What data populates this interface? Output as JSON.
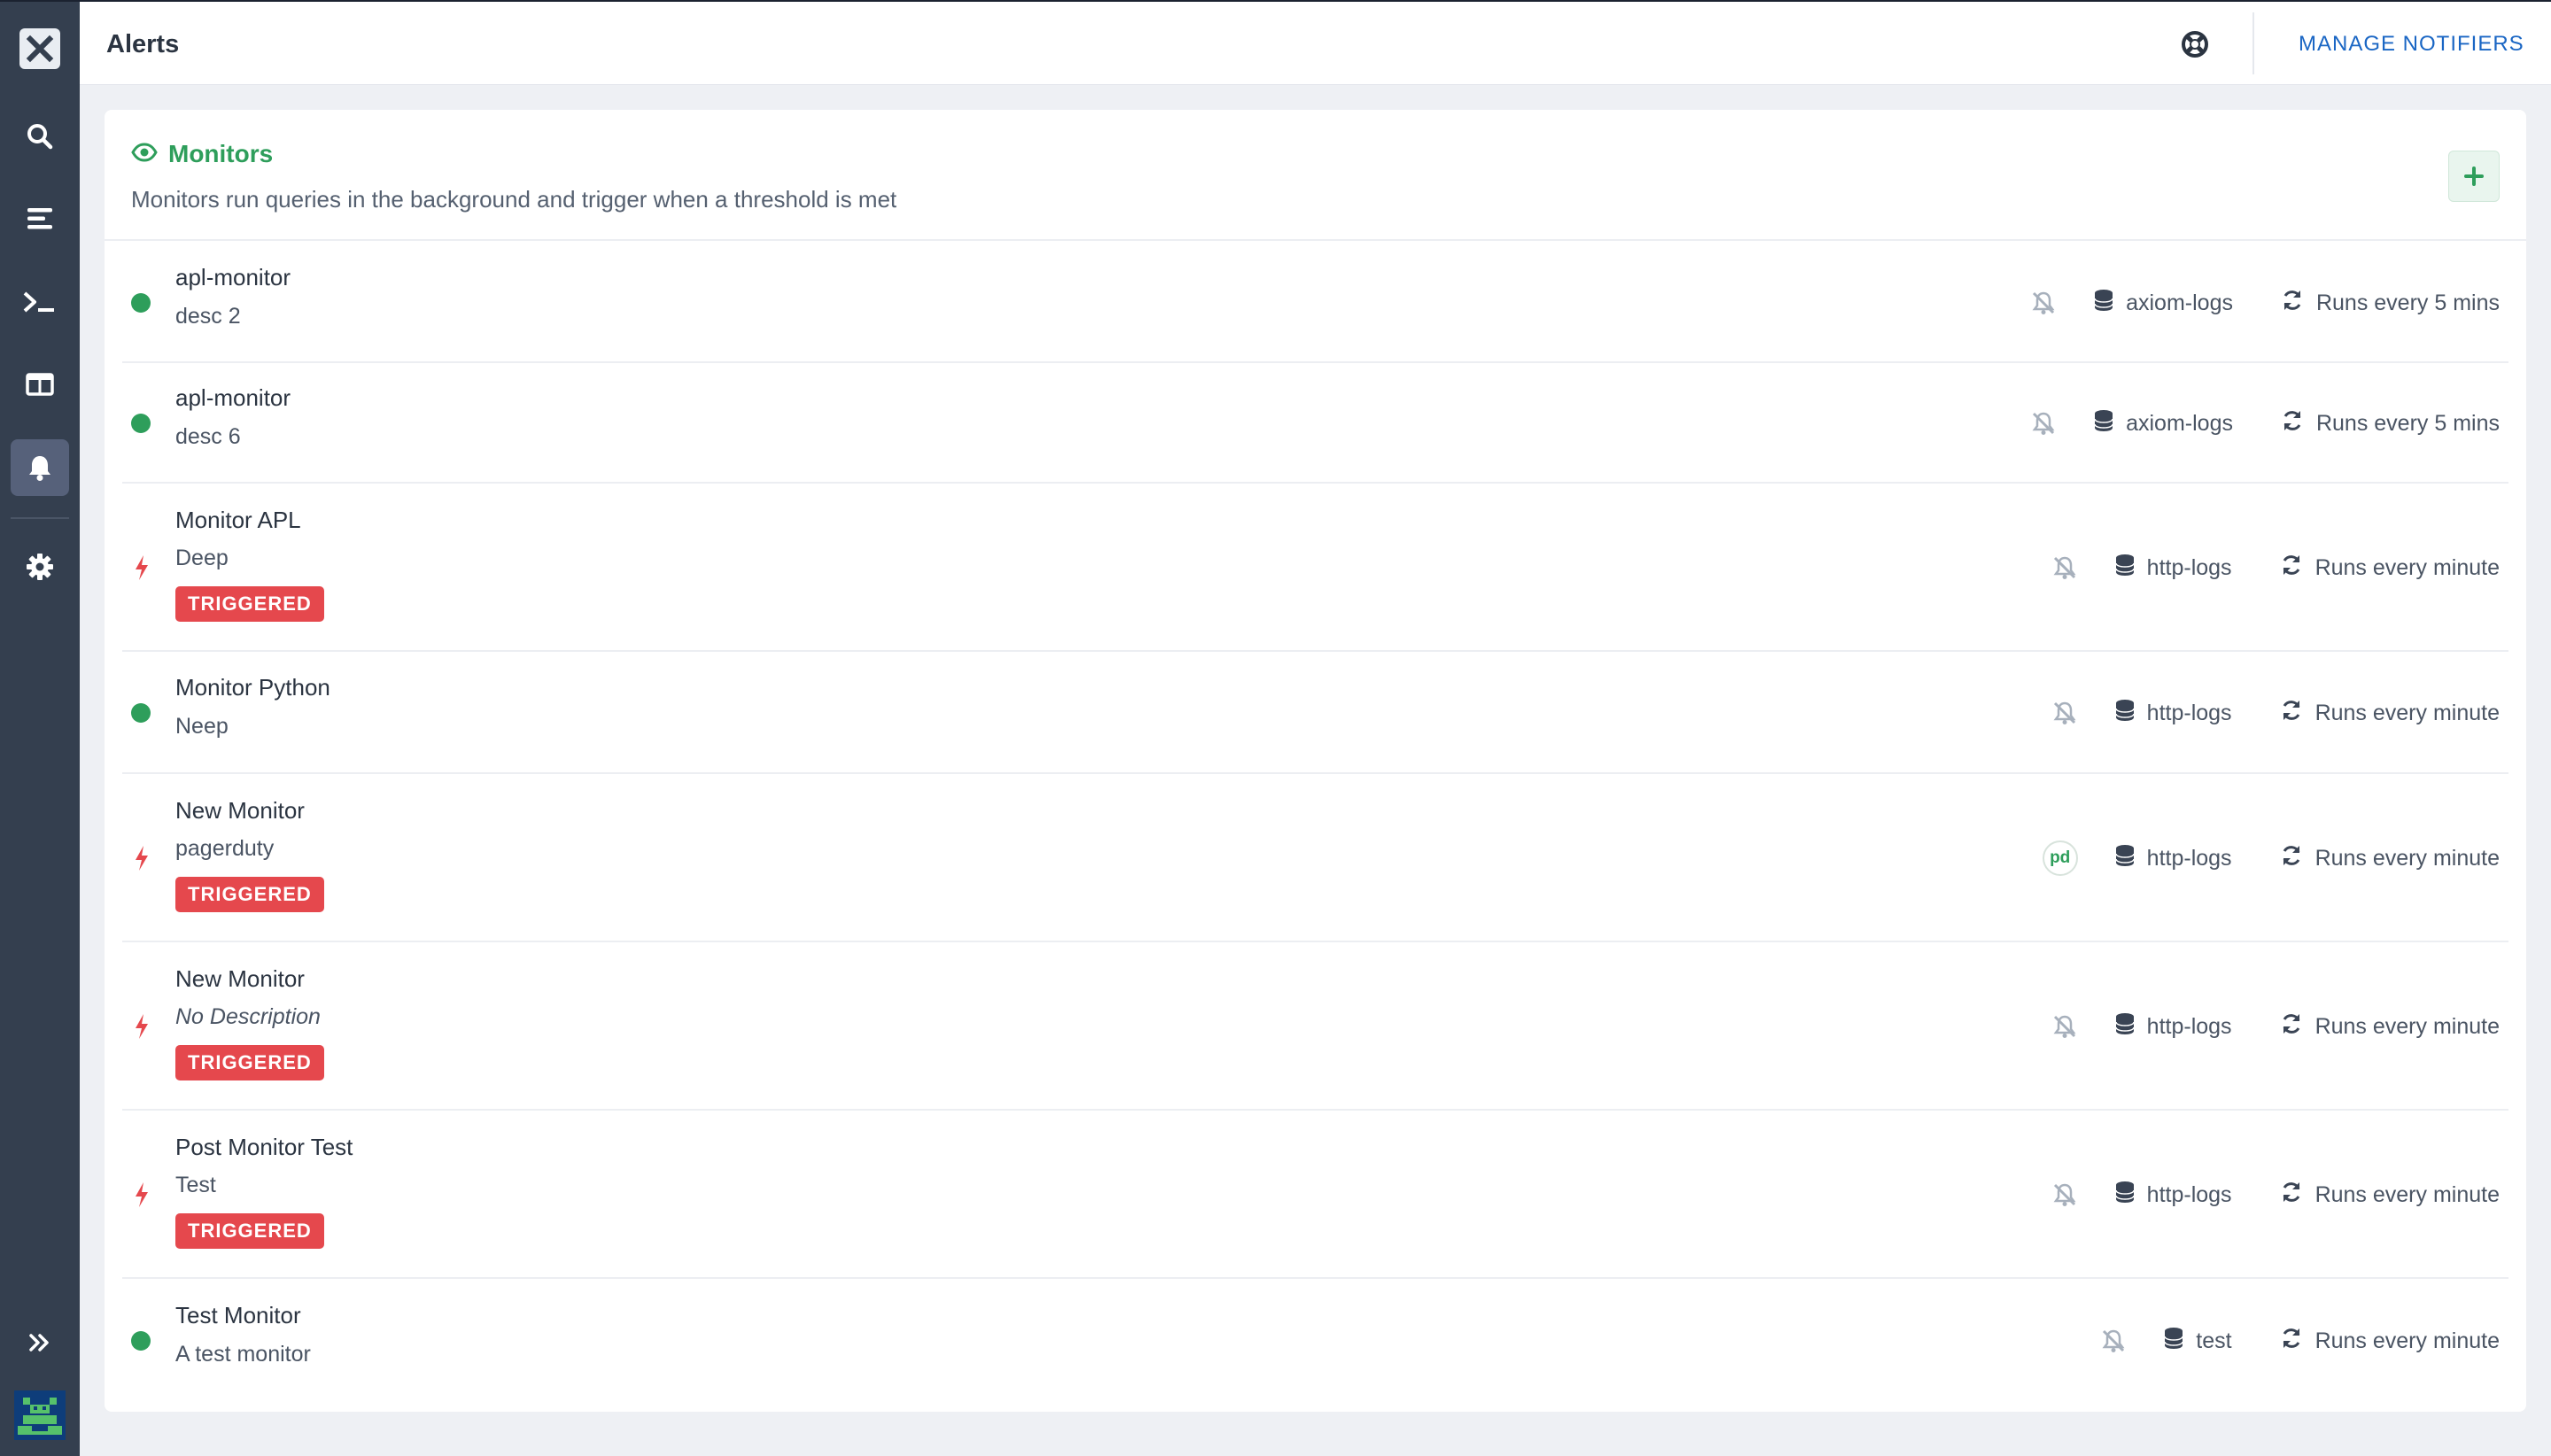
{
  "header": {
    "title": "Alerts",
    "manage_label": "MANAGE NOTIFIERS"
  },
  "sidebar": {
    "items": [
      {
        "name": "logo",
        "icon": "axiom-logo-icon"
      },
      {
        "name": "search",
        "icon": "search-icon"
      },
      {
        "name": "stream",
        "icon": "stream-icon"
      },
      {
        "name": "query",
        "icon": "terminal-icon"
      },
      {
        "name": "dashboards",
        "icon": "dashboard-icon"
      },
      {
        "name": "alerts",
        "icon": "bell-icon",
        "active": true
      },
      {
        "name": "settings",
        "icon": "gear-icon"
      },
      {
        "name": "expand",
        "icon": "double-chevron-right-icon"
      }
    ]
  },
  "monitors": {
    "title": "Monitors",
    "description": "Monitors run queries in the background and trigger when a threshold is met",
    "rows": [
      {
        "name": "apl-monitor",
        "desc": "desc 2",
        "status": "ok",
        "notifier": "muted",
        "dataset": "axiom-logs",
        "schedule": "Runs every 5 mins"
      },
      {
        "name": "apl-monitor",
        "desc": "desc 6",
        "status": "ok",
        "notifier": "muted",
        "dataset": "axiom-logs",
        "schedule": "Runs every 5 mins"
      },
      {
        "name": "Monitor APL",
        "desc": "Deep",
        "status": "triggered",
        "badge": "TRIGGERED",
        "notifier": "muted",
        "dataset": "http-logs",
        "schedule": "Runs every minute"
      },
      {
        "name": "Monitor Python",
        "desc": "Neep",
        "status": "ok",
        "notifier": "muted",
        "dataset": "http-logs",
        "schedule": "Runs every minute"
      },
      {
        "name": "New Monitor",
        "desc": "pagerduty",
        "status": "triggered",
        "badge": "TRIGGERED",
        "notifier": "pd",
        "notifier_label": "pd",
        "dataset": "http-logs",
        "schedule": "Runs every minute"
      },
      {
        "name": "New Monitor",
        "desc": "No Description",
        "status": "triggered",
        "badge": "TRIGGERED",
        "notifier": "muted",
        "dataset": "http-logs",
        "schedule": "Runs every minute"
      },
      {
        "name": "Post Monitor Test",
        "desc": "Test",
        "status": "triggered",
        "badge": "TRIGGERED",
        "notifier": "muted",
        "dataset": "http-logs",
        "schedule": "Runs every minute"
      },
      {
        "name": "Test Monitor",
        "desc": "A test monitor",
        "status": "ok",
        "notifier": "muted",
        "dataset": "test",
        "schedule": "Runs every minute"
      }
    ]
  },
  "colors": {
    "sidebar_bg": "#343f4f",
    "accent_green": "#2e9e5b",
    "triggered_red": "#e5484d",
    "link_blue": "#1a66c4"
  }
}
